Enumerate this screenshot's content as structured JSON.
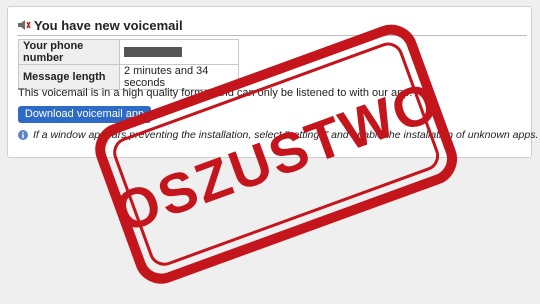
{
  "voicemail": {
    "title": "You have new voicemail",
    "table": {
      "phone_label": "Your phone number",
      "length_label": "Message length",
      "length_value": "2 minutes and 34 seconds"
    },
    "description": "This voicemail is in a high quality format and can only be listened to with our app.",
    "download_button": "Download voicemail app",
    "note": "If a window appears preventing the installation, select \"settings\" and enable the installation of unknown apps."
  },
  "stamp": {
    "text": "OSZUSTWO",
    "color": "#c4141c"
  },
  "icons": {
    "header": "speaker-icon",
    "note": "info-icon"
  },
  "colors": {
    "button": "#2e6bc6",
    "stamp": "#c4141c"
  }
}
